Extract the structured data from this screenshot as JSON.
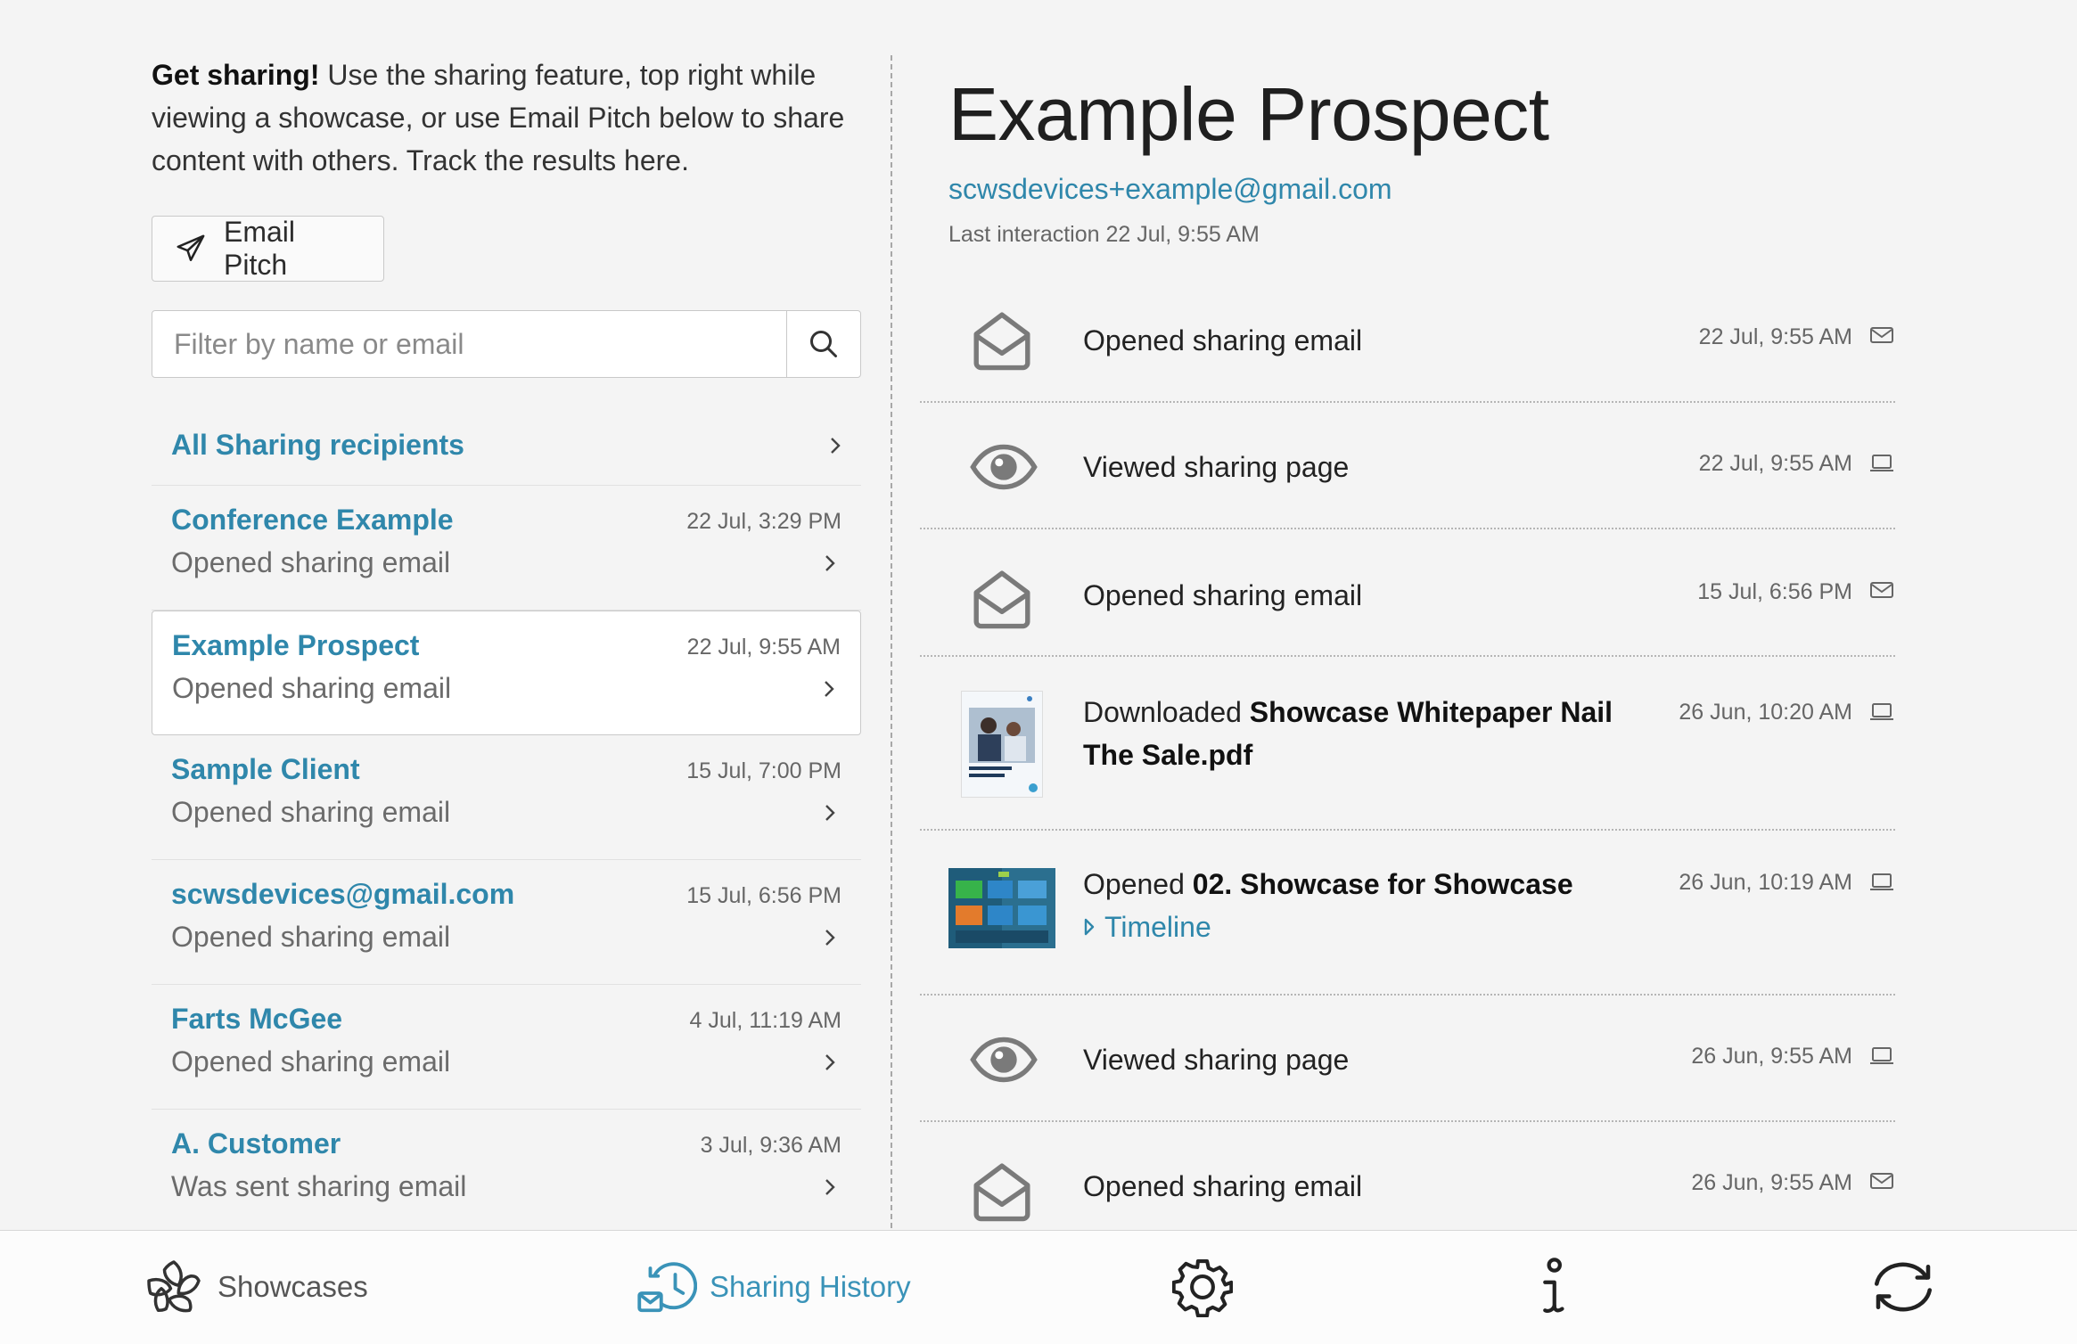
{
  "intro": {
    "bold": "Get sharing!",
    "text": " Use the sharing feature, top right while viewing a showcase, or use Email Pitch below to share content with others. Track the results here."
  },
  "email_pitch_label": "Email Pitch",
  "filter": {
    "placeholder": "Filter by name or email"
  },
  "all_recipients_label": "All Sharing recipients",
  "recipients": [
    {
      "name": "Conference Example",
      "time": "22 Jul, 3:29 PM",
      "activity": "Opened sharing email",
      "selected": false
    },
    {
      "name": "Example Prospect",
      "time": "22 Jul, 9:55 AM",
      "activity": "Opened sharing email",
      "selected": true
    },
    {
      "name": "Sample Client",
      "time": "15 Jul, 7:00 PM",
      "activity": "Opened sharing email",
      "selected": false
    },
    {
      "name": "scwsdevices@gmail.com",
      "time": "15 Jul, 6:56 PM",
      "activity": "Opened sharing email",
      "selected": false
    },
    {
      "name": "Farts McGee",
      "time": "4 Jul, 11:19 AM",
      "activity": "Opened sharing email",
      "selected": false
    },
    {
      "name": "A. Customer",
      "time": "3 Jul, 9:36 AM",
      "activity": "Was sent sharing email",
      "selected": false
    }
  ],
  "prospect": {
    "name": "Example Prospect",
    "email": "scwsdevices+example@gmail.com",
    "last_interaction": "Last interaction 22 Jul, 9:55 AM"
  },
  "events": [
    {
      "icon": "open-envelope-icon",
      "text": "Opened sharing email",
      "time": "22 Jul, 9:55 AM",
      "device": "mail-icon"
    },
    {
      "icon": "eye-icon",
      "text": "Viewed sharing page",
      "time": "22 Jul, 9:55 AM",
      "device": "laptop-icon"
    },
    {
      "icon": "open-envelope-icon",
      "text": "Opened sharing email",
      "time": "15 Jul, 6:56 PM",
      "device": "mail-icon"
    },
    {
      "icon": "pdf-thumbnail",
      "prefix": "Downloaded ",
      "bold": "Showcase Whitepaper Nail The Sale.pdf",
      "time": "26 Jun, 10:20 AM",
      "device": "laptop-icon"
    },
    {
      "icon": "showcase-thumbnail",
      "prefix": "Opened ",
      "bold": "02. Showcase for Showcase",
      "link": "Timeline",
      "time": "26 Jun, 10:19 AM",
      "device": "laptop-icon"
    },
    {
      "icon": "eye-icon",
      "text": "Viewed sharing page",
      "time": "26 Jun, 9:55 AM",
      "device": "laptop-icon"
    },
    {
      "icon": "open-envelope-icon",
      "text": "Opened sharing email",
      "time": "26 Jun, 9:55 AM",
      "device": "mail-icon"
    }
  ],
  "nav": {
    "showcases": "Showcases",
    "sharing_history": "Sharing History",
    "active": "sharing_history"
  },
  "colors": {
    "accent": "#2f87ab",
    "active_tab": "#3a93b8"
  }
}
